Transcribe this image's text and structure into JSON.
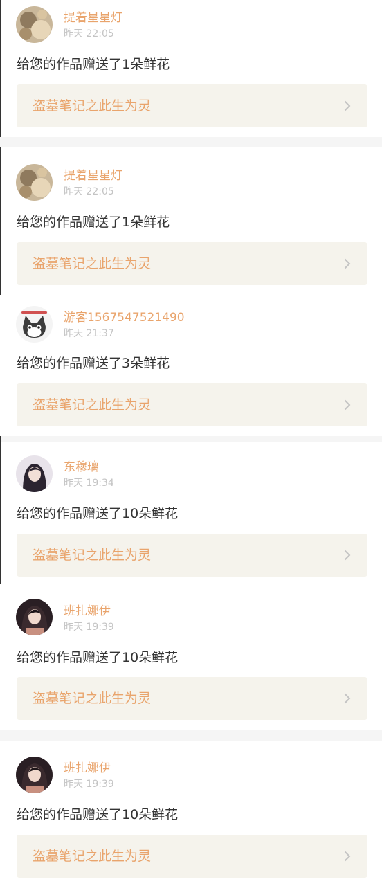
{
  "notifications": [
    {
      "username": "提着星星灯",
      "time": "昨天 22:05",
      "message": "给您的作品赠送了1朵鲜花",
      "work_title": "盗墓笔记之此生为灵",
      "avatar_icon": "photo-avatar-icon"
    },
    {
      "username": "提着星星灯",
      "time": "昨天 22:05",
      "message": "给您的作品赠送了1朵鲜花",
      "work_title": "盗墓笔记之此生为灵",
      "avatar_icon": "photo-avatar-icon"
    },
    {
      "username": "游客1567547521490",
      "time": "昨天 21:37",
      "message": "给您的作品赠送了3朵鲜花",
      "work_title": "盗墓笔记之此生为灵",
      "avatar_icon": "cat-avatar-icon"
    },
    {
      "username": "东穆璃",
      "time": "昨天 19:34",
      "message": "给您的作品赠送了10朵鲜花",
      "work_title": "盗墓笔记之此生为灵",
      "avatar_icon": "photo-avatar-icon"
    },
    {
      "username": "班扎娜伊",
      "time": "昨天 19:39",
      "message": "给您的作品赠送了10朵鲜花",
      "work_title": "盗墓笔记之此生为灵",
      "avatar_icon": "photo-avatar-icon"
    },
    {
      "username": "班扎娜伊",
      "time": "昨天 19:39",
      "message": "给您的作品赠送了10朵鲜花",
      "work_title": "盗墓笔记之此生为灵",
      "avatar_icon": "photo-avatar-icon"
    }
  ],
  "colors": {
    "accent": "#e9a46c",
    "timestamp": "#c4c4c4",
    "text": "#333333",
    "link_bg": "#f5f3ec",
    "separator": "#f5f5f5"
  },
  "icons": {
    "chevron": "chevron-right-icon"
  }
}
